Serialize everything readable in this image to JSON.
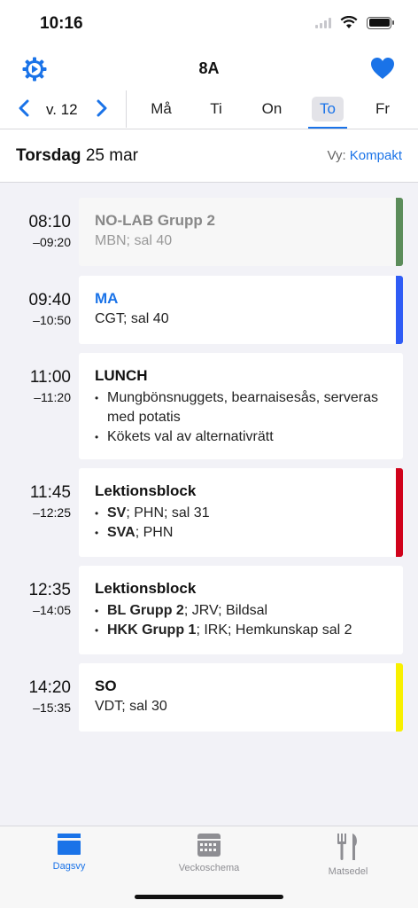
{
  "status": {
    "time": "10:16"
  },
  "header": {
    "title": "8A"
  },
  "week": {
    "label": "v. 12",
    "days": [
      "Må",
      "Ti",
      "On",
      "To",
      "Fr"
    ],
    "selected_day": "To"
  },
  "date": {
    "weekday": "Torsdag",
    "date": "25 mar",
    "view_prefix": "Vy:",
    "view_value": "Kompakt"
  },
  "lessons": [
    {
      "start": "08:10",
      "end": "–09:20",
      "title": "NO-LAB  Grupp 2",
      "detail": "MBN; sal 40",
      "color": "#5b8c5a"
    },
    {
      "start": "09:40",
      "end": "–10:50",
      "title": "MA",
      "detail": "CGT; sal 40",
      "color": "#2f5cf5"
    },
    {
      "start": "11:00",
      "end": "–11:20",
      "title": "LUNCH",
      "items": [
        "Mungbönsnuggets, bearnaisesås, serveras med potatis",
        "Kökets val av alternativrätt"
      ]
    },
    {
      "start": "11:45",
      "end": "–12:25",
      "title": "Lektionsblock",
      "items": [
        {
          "b": "SV",
          "rest": "; PHN; sal 31"
        },
        {
          "b": "SVA",
          "rest": "; PHN"
        }
      ],
      "color": "#d0021b"
    },
    {
      "start": "12:35",
      "end": "–14:05",
      "title": "Lektionsblock",
      "items": [
        {
          "b": "BL  Grupp 2",
          "rest": "; JRV; Bildsal"
        },
        {
          "b": "HKK  Grupp 1",
          "rest": "; IRK; Hemkunskap sal 2"
        }
      ]
    },
    {
      "start": "14:20",
      "end": "–15:35",
      "title": "SO",
      "detail": "VDT; sal 30",
      "color": "#f8f000"
    }
  ],
  "tabs": [
    {
      "label": "Dagsvy",
      "icon": "day-view-icon"
    },
    {
      "label": "Veckoschema",
      "icon": "calendar-week-icon"
    },
    {
      "label": "Matsedel",
      "icon": "fork-knife-icon"
    }
  ],
  "colors": {
    "accent": "#1a73e8",
    "heart": "#1a73e8"
  }
}
